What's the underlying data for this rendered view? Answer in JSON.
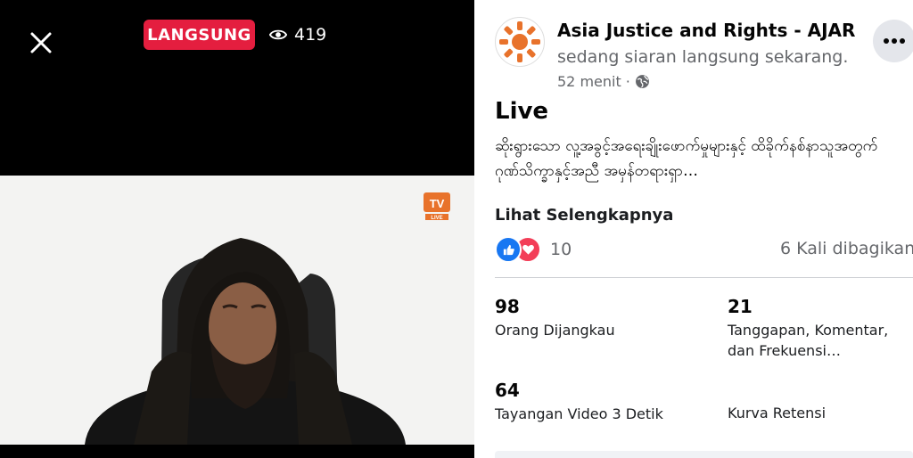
{
  "player": {
    "live_label": "LANGSUNG",
    "viewer_count": "419",
    "watermark_text": "TV LIVE"
  },
  "post": {
    "page_name": "Asia Justice and Rights - AJAR",
    "status": "sedang siaran langsung sekarang.",
    "time": "52 menit",
    "time_separator": "·",
    "title": "Live",
    "body": "ဆိုးရွားသော လူ့အခွင့်အရေးချိုးဖောက်မှုများနှင့် ထိခိုက်နစ်နာသူအတွက် ဂုဏ်သိက္ခာနှင့်အညီ အမှန်တရားရှာ…",
    "see_more": "Lihat Selengkapnya"
  },
  "engagement": {
    "reaction_count": "10",
    "shares": "6 Kali dibagikan"
  },
  "stats": [
    {
      "value": "98",
      "label": "Orang Dijangkau"
    },
    {
      "value": "21",
      "label": "Tanggapan, Komentar, dan Frekuensi…"
    },
    {
      "value": "64",
      "label": "Tayangan Video 3 Detik"
    },
    {
      "value": "",
      "label": "Kurva Retensi"
    }
  ],
  "colors": {
    "live_red": "#e41e3f",
    "like_blue": "#1877f2",
    "love_red": "#f33e58",
    "logo_orange": "#e8722b"
  },
  "icons": {
    "close": "close-icon",
    "viewers": "eye-icon",
    "more": "more-icon",
    "privacy": "globe-icon",
    "like": "like-icon",
    "love": "love-icon"
  }
}
